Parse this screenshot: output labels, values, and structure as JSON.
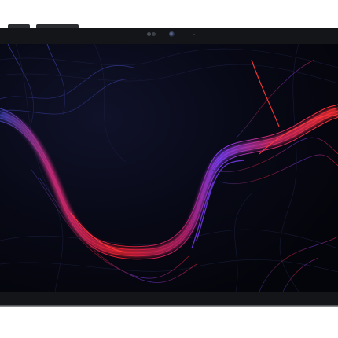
{
  "device": {
    "type": "tablet",
    "frame_color": "#141518",
    "orientation": "landscape"
  },
  "wallpaper": {
    "style": "abstract flowing lines",
    "colors": {
      "background": "#05060d",
      "red": "#e0202e",
      "magenta": "#c02a78",
      "purple": "#7a3cf0",
      "blue": "#3a3fb0"
    }
  }
}
